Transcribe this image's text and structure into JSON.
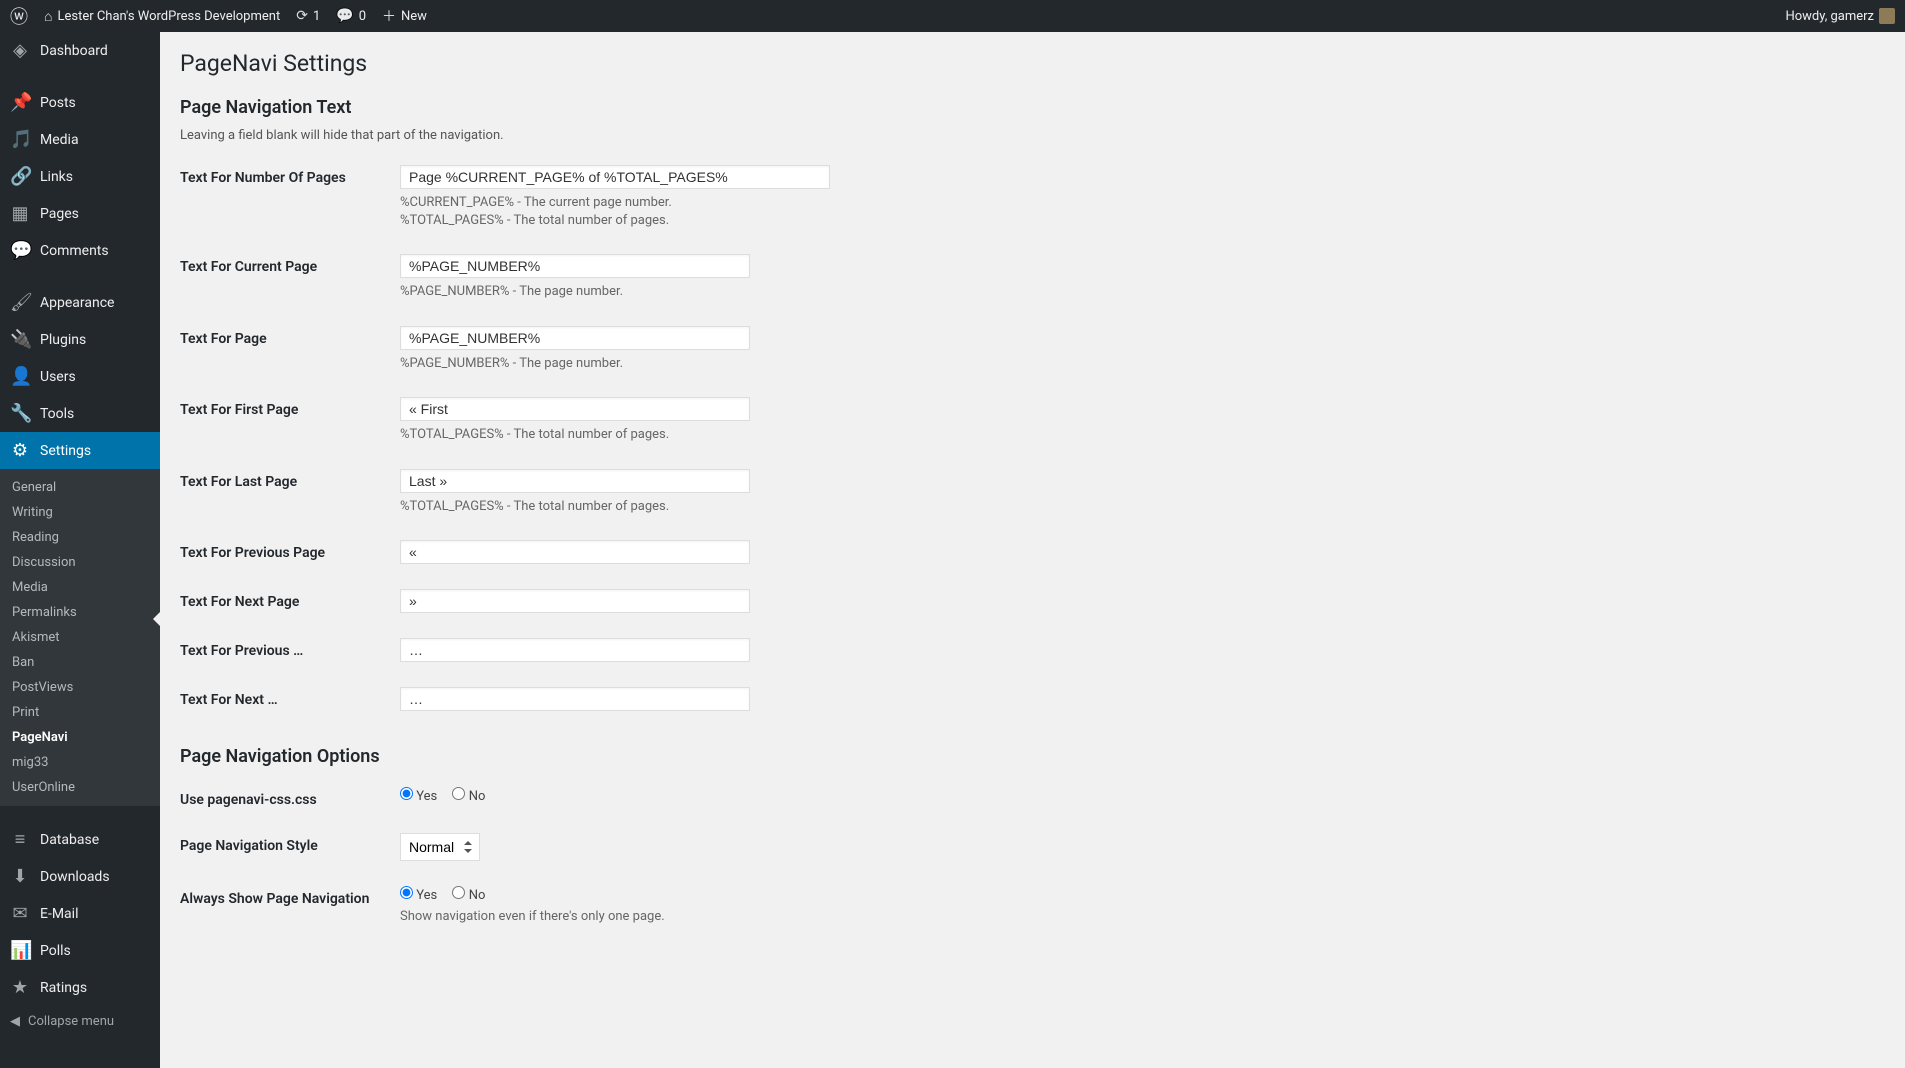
{
  "adminbar": {
    "site_name": "Lester Chan's WordPress Development",
    "updates_count": "1",
    "comments_count": "0",
    "new_label": "New",
    "howdy": "Howdy, gamerz"
  },
  "sidebar": {
    "dashboard": "Dashboard",
    "posts": "Posts",
    "media": "Media",
    "links": "Links",
    "pages": "Pages",
    "comments": "Comments",
    "appearance": "Appearance",
    "plugins": "Plugins",
    "users": "Users",
    "tools": "Tools",
    "settings": "Settings",
    "database": "Database",
    "downloads": "Downloads",
    "email": "E-Mail",
    "polls": "Polls",
    "ratings": "Ratings",
    "collapse": "Collapse menu",
    "submenu": {
      "general": "General",
      "writing": "Writing",
      "reading": "Reading",
      "discussion": "Discussion",
      "media": "Media",
      "permalinks": "Permalinks",
      "akismet": "Akismet",
      "ban": "Ban",
      "postviews": "PostViews",
      "print": "Print",
      "pagenavi": "PageNavi",
      "mig33": "mig33",
      "useronline": "UserOnline"
    }
  },
  "page": {
    "title": "PageNavi Settings",
    "section1": "Page Navigation Text",
    "section1_desc": "Leaving a field blank will hide that part of the navigation.",
    "section2": "Page Navigation Options"
  },
  "fields": {
    "num_pages": {
      "label": "Text For Number Of Pages",
      "value": "Page %CURRENT_PAGE% of %TOTAL_PAGES%",
      "hint1": "%CURRENT_PAGE% - The current page number.",
      "hint2": "%TOTAL_PAGES% - The total number of pages."
    },
    "current_page": {
      "label": "Text For Current Page",
      "value": "%PAGE_NUMBER%",
      "hint": "%PAGE_NUMBER% - The page number."
    },
    "page": {
      "label": "Text For Page",
      "value": "%PAGE_NUMBER%",
      "hint": "%PAGE_NUMBER% - The page number."
    },
    "first_page": {
      "label": "Text For First Page",
      "value": "« First",
      "hint": "%TOTAL_PAGES% - The total number of pages."
    },
    "last_page": {
      "label": "Text For Last Page",
      "value": "Last »",
      "hint": "%TOTAL_PAGES% - The total number of pages."
    },
    "prev_page": {
      "label": "Text For Previous Page",
      "value": "«"
    },
    "next_page": {
      "label": "Text For Next Page",
      "value": "»"
    },
    "prev_dots": {
      "label": "Text For Previous …",
      "value": "…"
    },
    "next_dots": {
      "label": "Text For Next …",
      "value": "…"
    },
    "use_css": {
      "label": "Use pagenavi-css.css",
      "yes": "Yes",
      "no": "No"
    },
    "style": {
      "label": "Page Navigation Style",
      "value": "Normal"
    },
    "always_show": {
      "label": "Always Show Page Navigation",
      "yes": "Yes",
      "no": "No",
      "hint": "Show navigation even if there's only one page."
    }
  }
}
